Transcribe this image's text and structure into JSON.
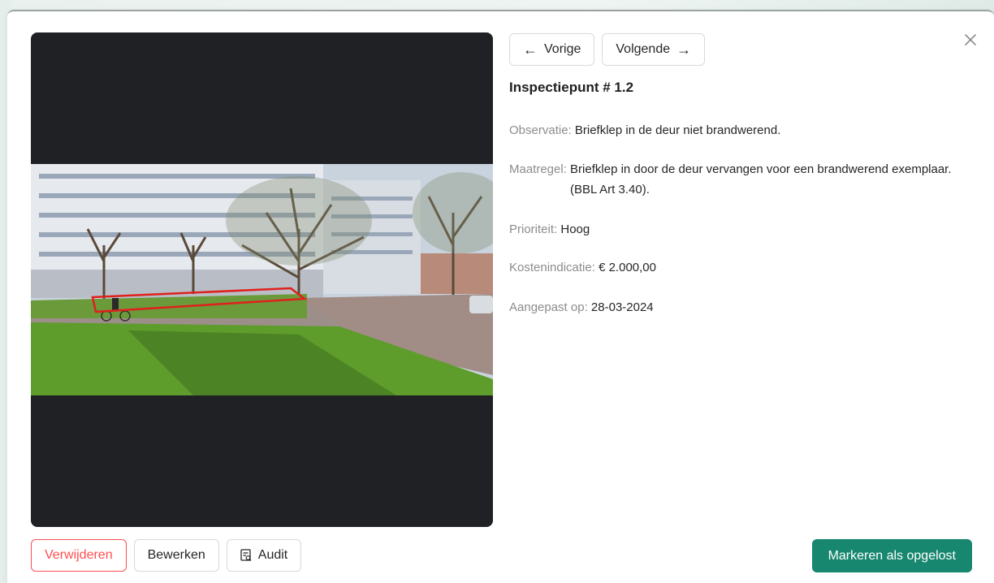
{
  "nav": {
    "prev_label": "Vorige",
    "prev_arrow": "←",
    "next_label": "Volgende",
    "next_arrow": "→"
  },
  "close_icon": "close-icon",
  "title": "Inspectiepunt # 1.2",
  "fields": {
    "observatie": {
      "label": "Observatie:",
      "value": "Briefklep in de deur niet brandwerend."
    },
    "maatregel": {
      "label": "Maatregel:",
      "value": "Briefklep in door de deur vervangen voor een brandwerend exemplaar. (BBL Art 3.40)."
    },
    "prioriteit": {
      "label": "Prioriteit:",
      "value": "Hoog"
    },
    "kostenindicatie": {
      "label": "Kostenindicatie:",
      "value": "€ 2.000,00"
    },
    "aangepast": {
      "label": "Aangepast op:",
      "value": "28-03-2024"
    }
  },
  "actions": {
    "delete_label": "Verwijderen",
    "edit_label": "Bewerken",
    "audit_label": "Audit",
    "resolve_label": "Markeren als opgelost"
  },
  "colors": {
    "primary": "#17876f",
    "danger": "#ff4d4f",
    "photo_background": "#202124",
    "annotation": "#e0201d"
  }
}
